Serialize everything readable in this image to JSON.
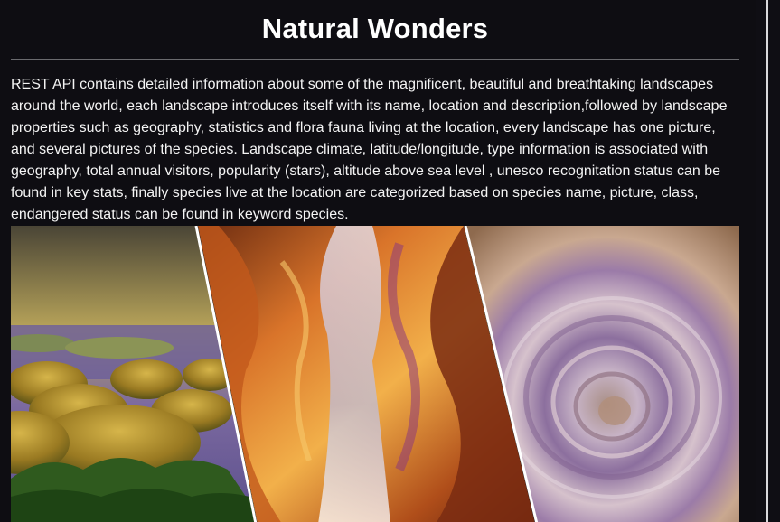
{
  "page": {
    "title": "Natural Wonders",
    "description": "REST API contains detailed information about some of the magnificent, beautiful and breathtaking landscapes around the world, each landscape introduces itself with its name, location and description,followed by landscape properties such as geography, statistics and flora fauna living at the location, every landscape has one picture, and several pictures of the species. Landscape climate, latitude/longitude, type information is associated with geography, total annual visitors, popularity (stars), altitude above sea level , unesco recognitation status can be found in key stats, finally species live at the location are categorized based on species name, picture, class, endangered status can be found in keyword species."
  },
  "hero": {
    "panels": [
      "hills-landscape",
      "canyon-landscape",
      "eye-of-sahara-landscape"
    ]
  },
  "colors": {
    "background": "#0e0d12",
    "text": "#ffffff",
    "rule": "#6a6a6e"
  }
}
